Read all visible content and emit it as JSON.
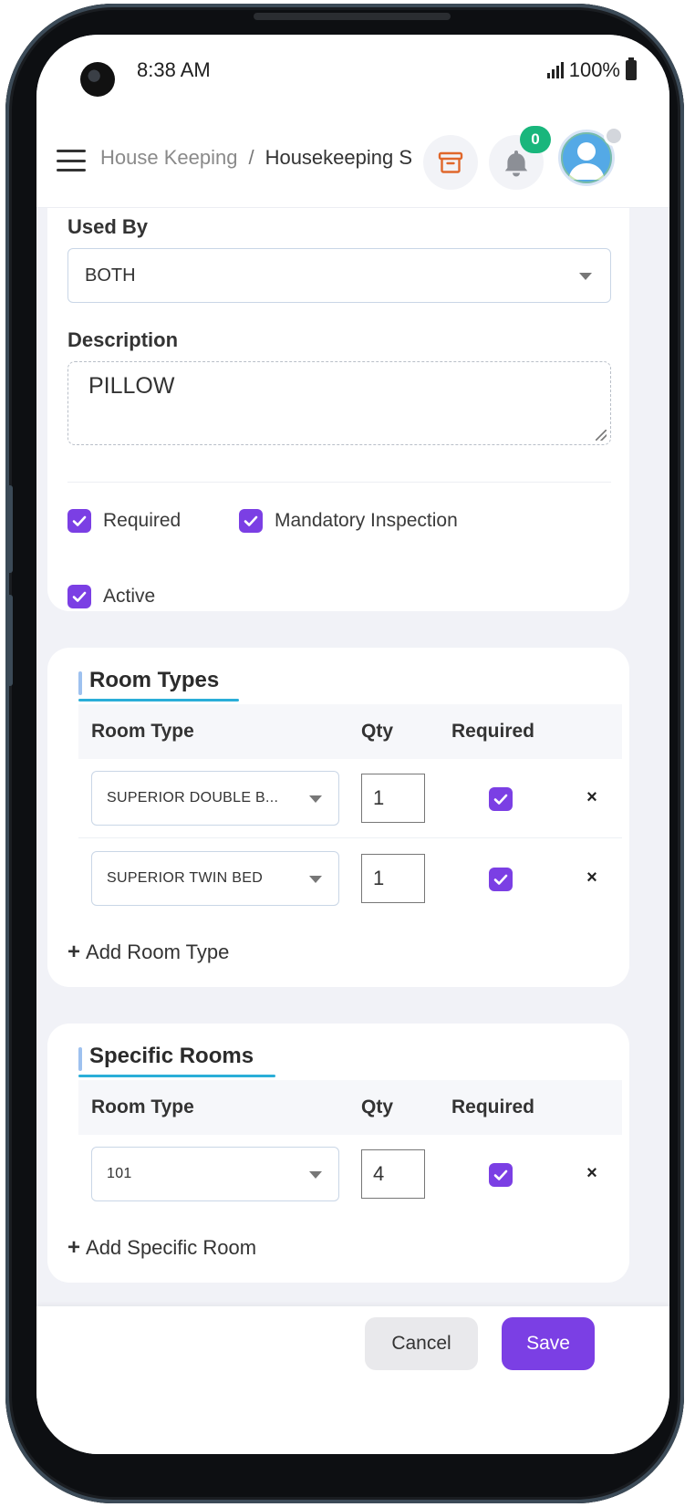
{
  "status_bar": {
    "time": "8:38 AM",
    "battery": "100%"
  },
  "header": {
    "breadcrumb_parent": "House Keeping",
    "breadcrumb_separator": "/",
    "breadcrumb_current": "Housekeeping Setup",
    "notification_count": "0"
  },
  "form": {
    "used_by_label": "Used By",
    "used_by_value": "BOTH",
    "description_label": "Description",
    "description_value": "PILLOW",
    "checkboxes": {
      "required": "Required",
      "mandatory_inspection": "Mandatory Inspection",
      "active": "Active"
    }
  },
  "room_types": {
    "title": "Room Types",
    "columns": [
      "Room Type",
      "Qty",
      "Required"
    ],
    "rows": [
      {
        "room_type": "SUPERIOR DOUBLE B...",
        "qty": "1",
        "required": true
      },
      {
        "room_type": "SUPERIOR TWIN BED",
        "qty": "1",
        "required": true
      }
    ],
    "add_label": "Add Room Type"
  },
  "specific_rooms": {
    "title": "Specific Rooms",
    "columns": [
      "Room Type",
      "Qty",
      "Required"
    ],
    "rows": [
      {
        "room": "101",
        "qty": "4",
        "required": true
      }
    ],
    "add_label": "Add Specific Room"
  },
  "footer": {
    "cancel_label": "Cancel",
    "save_label": "Save"
  },
  "colors": {
    "accent": "#7b3fe4",
    "badge": "#19b67c",
    "underline": "#2aaed8",
    "archive_icon": "#e0672b"
  }
}
